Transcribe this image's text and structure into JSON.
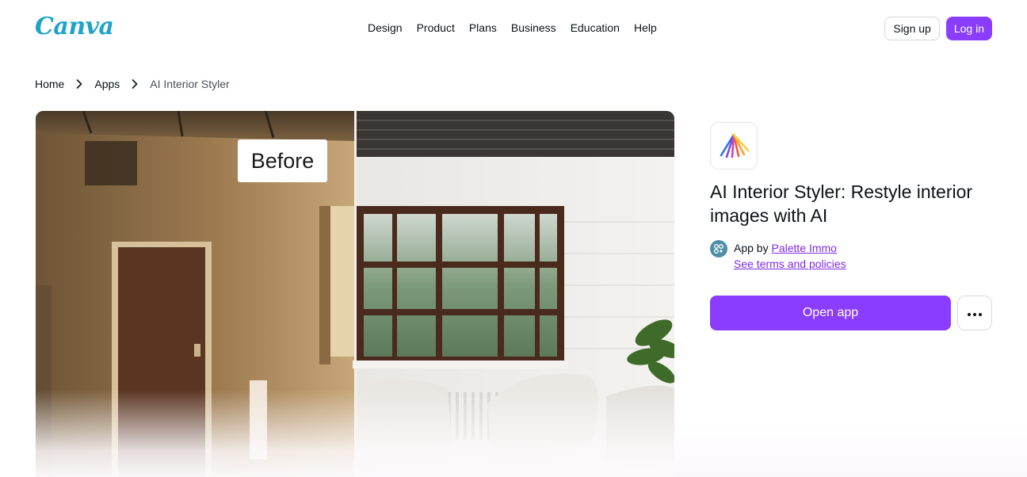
{
  "header": {
    "logo_text": "Canva",
    "nav": [
      "Design",
      "Product",
      "Plans",
      "Business",
      "Education",
      "Help"
    ],
    "signup_label": "Sign up",
    "login_label": "Log in"
  },
  "breadcrumb": [
    "Home",
    "Apps",
    "AI Interior Styler"
  ],
  "preview": {
    "before_label": "Before"
  },
  "app": {
    "title": "AI Interior Styler: Restyle interior images with AI",
    "by_prefix": "App by",
    "developer": "Palette Immo",
    "terms_label": "See terms and policies",
    "open_label": "Open app",
    "more_icon": "more-horizontal-icon"
  },
  "colors": {
    "accent": "#8b3dff",
    "link": "#7d2ae8",
    "text": "#0e1318"
  }
}
